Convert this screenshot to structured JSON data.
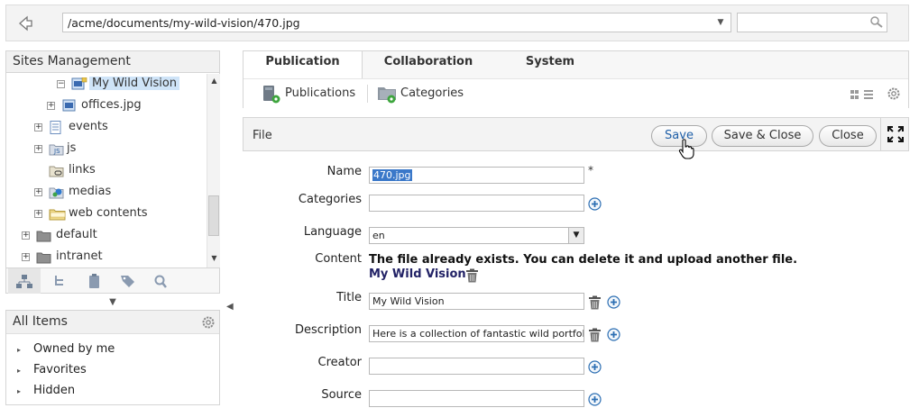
{
  "address": {
    "path": "/acme/documents/my-wild-vision/470.jpg"
  },
  "search": {
    "placeholder": ""
  },
  "sites": {
    "title": "Sites Management",
    "tree": [
      {
        "label": "My Wild Vision"
      },
      {
        "label": "offices.jpg"
      },
      {
        "label": "events"
      },
      {
        "label": "js"
      },
      {
        "label": "links"
      },
      {
        "label": "medias"
      },
      {
        "label": "web contents"
      },
      {
        "label": "default"
      },
      {
        "label": "intranet"
      }
    ]
  },
  "items": {
    "title": "All Items",
    "list": [
      {
        "label": "Owned by me"
      },
      {
        "label": "Favorites"
      },
      {
        "label": "Hidden"
      }
    ]
  },
  "tabs": [
    {
      "label": "Publication"
    },
    {
      "label": "Collaboration"
    },
    {
      "label": "System"
    }
  ],
  "subbar": {
    "publications": "Publications",
    "categories": "Categories"
  },
  "file": {
    "title": "File",
    "save": "Save",
    "save_close": "Save & Close",
    "close": "Close"
  },
  "form": {
    "name_label": "Name",
    "name_value": "470.jpg",
    "required": "*",
    "categories_label": "Categories",
    "language_label": "Language",
    "language_value": "en",
    "content_label": "Content",
    "content_message": "The file already exists. You can delete it and upload another file.",
    "content_link": "My Wild Vision",
    "title_label": "Title",
    "title_value": "My Wild Vision",
    "description_label": "Description",
    "description_value": "Here is a collection of fantastic wild portfolio.",
    "creator_label": "Creator",
    "source_label": "Source"
  },
  "colors": {
    "accent": "#1f5fa8",
    "selection": "#cfe4f8",
    "plus": "#2d6fb3",
    "gear-badge": "#3da53d"
  }
}
